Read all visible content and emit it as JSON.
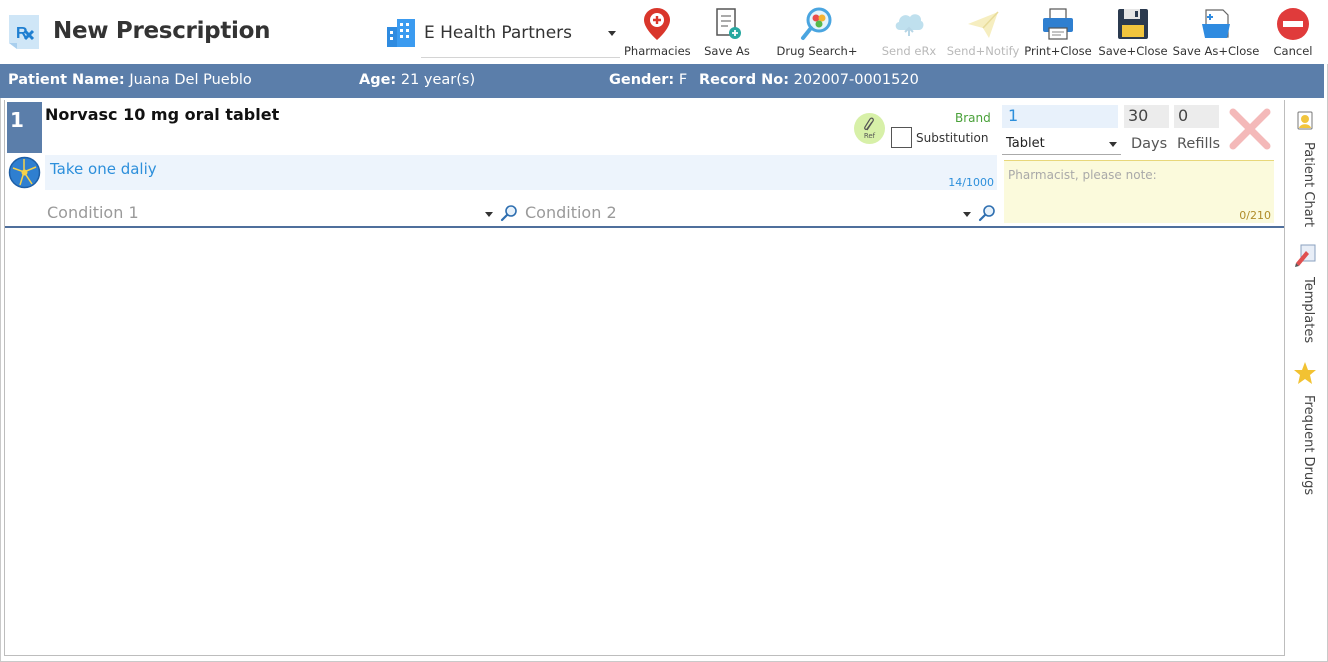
{
  "header": {
    "title": "New Prescription",
    "organization": "E Health Partners"
  },
  "toolbar": {
    "pharmacies": "Pharmacies",
    "save_as": "Save As",
    "drug_search": "Drug Search+",
    "send_erx": "Send eRx",
    "send_notify": "Send+Notify",
    "print_close": "Print+Close",
    "save_close": "Save+Close",
    "save_as_close": "Save As+Close",
    "cancel": "Cancel"
  },
  "patient": {
    "name_label": "Patient Name:",
    "name": "Juana Del Pueblo",
    "age_label": "Age:",
    "age": "21 year(s)",
    "gender_label": "Gender:",
    "gender": "F",
    "record_label": "Record No:",
    "record": "202007-0001520"
  },
  "prescription": {
    "number": "1",
    "drug": "Norvasc 10 mg oral tablet",
    "ref_label": "Ref",
    "brand_label": "Brand",
    "substitution_label": "Substitution",
    "substitution_checked": false,
    "quantity": "1",
    "days": "30",
    "refills": "0",
    "form": "Tablet",
    "days_label": "Days",
    "refills_label": "Refills",
    "sig": "Take one daliy",
    "sig_count": "14/1000",
    "pharmacist_placeholder": "Pharmacist, please note:",
    "pharmacist_count": "0/210",
    "condition1": "Condition 1",
    "condition2": "Condition 2"
  },
  "side_panel": {
    "patient_chart": "Patient Chart",
    "templates": "Templates",
    "frequent_drugs": "Frequent Drugs"
  },
  "colors": {
    "patient_bar": "#5b7eaa",
    "sig_text": "#2d8fdb",
    "brand": "#4aa13a",
    "cancel": "#e03b3b"
  }
}
